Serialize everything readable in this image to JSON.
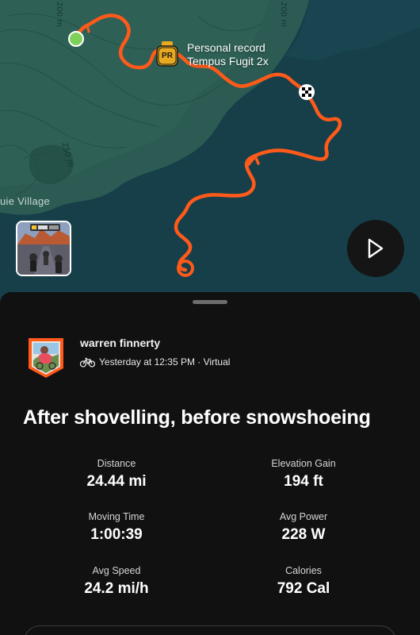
{
  "map": {
    "contour_labels": [
      "200 m",
      "200 m",
      "250 m"
    ],
    "place_label": "uie Village",
    "pr_badge": "PR",
    "pr_title": "Personal record",
    "pr_segment": "Tempus Fugit 2x",
    "colors": {
      "route": "#ff5a1a",
      "water": "#153f49",
      "land": "#2b5b52",
      "start": "#7fd05b"
    }
  },
  "play_button": {
    "icon": "play-icon"
  },
  "activity": {
    "athlete_name": "warren finnerty",
    "sport_icon": "bike-icon",
    "meta": "Yesterday at 12:35 PM · Virtual",
    "title": "After shovelling, before snowshoeing",
    "stats": [
      {
        "label": "Distance",
        "value": "24.44 mi"
      },
      {
        "label": "Elevation Gain",
        "value": "194 ft"
      },
      {
        "label": "Moving Time",
        "value": "1:00:39"
      },
      {
        "label": "Avg Power",
        "value": "228 W"
      },
      {
        "label": "Avg Speed",
        "value": "24.2 mi/h"
      },
      {
        "label": "Calories",
        "value": "792 Cal"
      }
    ]
  }
}
